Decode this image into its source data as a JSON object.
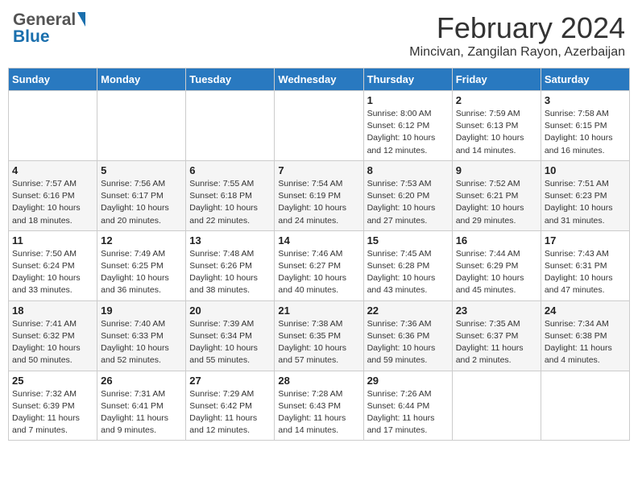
{
  "header": {
    "logo_general": "General",
    "logo_blue": "Blue",
    "month_year": "February 2024",
    "location": "Mincivan, Zangilan Rayon, Azerbaijan"
  },
  "weekdays": [
    "Sunday",
    "Monday",
    "Tuesday",
    "Wednesday",
    "Thursday",
    "Friday",
    "Saturday"
  ],
  "weeks": [
    [
      {
        "day": "",
        "info": ""
      },
      {
        "day": "",
        "info": ""
      },
      {
        "day": "",
        "info": ""
      },
      {
        "day": "",
        "info": ""
      },
      {
        "day": "1",
        "info": "Sunrise: 8:00 AM\nSunset: 6:12 PM\nDaylight: 10 hours\nand 12 minutes."
      },
      {
        "day": "2",
        "info": "Sunrise: 7:59 AM\nSunset: 6:13 PM\nDaylight: 10 hours\nand 14 minutes."
      },
      {
        "day": "3",
        "info": "Sunrise: 7:58 AM\nSunset: 6:15 PM\nDaylight: 10 hours\nand 16 minutes."
      }
    ],
    [
      {
        "day": "4",
        "info": "Sunrise: 7:57 AM\nSunset: 6:16 PM\nDaylight: 10 hours\nand 18 minutes."
      },
      {
        "day": "5",
        "info": "Sunrise: 7:56 AM\nSunset: 6:17 PM\nDaylight: 10 hours\nand 20 minutes."
      },
      {
        "day": "6",
        "info": "Sunrise: 7:55 AM\nSunset: 6:18 PM\nDaylight: 10 hours\nand 22 minutes."
      },
      {
        "day": "7",
        "info": "Sunrise: 7:54 AM\nSunset: 6:19 PM\nDaylight: 10 hours\nand 24 minutes."
      },
      {
        "day": "8",
        "info": "Sunrise: 7:53 AM\nSunset: 6:20 PM\nDaylight: 10 hours\nand 27 minutes."
      },
      {
        "day": "9",
        "info": "Sunrise: 7:52 AM\nSunset: 6:21 PM\nDaylight: 10 hours\nand 29 minutes."
      },
      {
        "day": "10",
        "info": "Sunrise: 7:51 AM\nSunset: 6:23 PM\nDaylight: 10 hours\nand 31 minutes."
      }
    ],
    [
      {
        "day": "11",
        "info": "Sunrise: 7:50 AM\nSunset: 6:24 PM\nDaylight: 10 hours\nand 33 minutes."
      },
      {
        "day": "12",
        "info": "Sunrise: 7:49 AM\nSunset: 6:25 PM\nDaylight: 10 hours\nand 36 minutes."
      },
      {
        "day": "13",
        "info": "Sunrise: 7:48 AM\nSunset: 6:26 PM\nDaylight: 10 hours\nand 38 minutes."
      },
      {
        "day": "14",
        "info": "Sunrise: 7:46 AM\nSunset: 6:27 PM\nDaylight: 10 hours\nand 40 minutes."
      },
      {
        "day": "15",
        "info": "Sunrise: 7:45 AM\nSunset: 6:28 PM\nDaylight: 10 hours\nand 43 minutes."
      },
      {
        "day": "16",
        "info": "Sunrise: 7:44 AM\nSunset: 6:29 PM\nDaylight: 10 hours\nand 45 minutes."
      },
      {
        "day": "17",
        "info": "Sunrise: 7:43 AM\nSunset: 6:31 PM\nDaylight: 10 hours\nand 47 minutes."
      }
    ],
    [
      {
        "day": "18",
        "info": "Sunrise: 7:41 AM\nSunset: 6:32 PM\nDaylight: 10 hours\nand 50 minutes."
      },
      {
        "day": "19",
        "info": "Sunrise: 7:40 AM\nSunset: 6:33 PM\nDaylight: 10 hours\nand 52 minutes."
      },
      {
        "day": "20",
        "info": "Sunrise: 7:39 AM\nSunset: 6:34 PM\nDaylight: 10 hours\nand 55 minutes."
      },
      {
        "day": "21",
        "info": "Sunrise: 7:38 AM\nSunset: 6:35 PM\nDaylight: 10 hours\nand 57 minutes."
      },
      {
        "day": "22",
        "info": "Sunrise: 7:36 AM\nSunset: 6:36 PM\nDaylight: 10 hours\nand 59 minutes."
      },
      {
        "day": "23",
        "info": "Sunrise: 7:35 AM\nSunset: 6:37 PM\nDaylight: 11 hours\nand 2 minutes."
      },
      {
        "day": "24",
        "info": "Sunrise: 7:34 AM\nSunset: 6:38 PM\nDaylight: 11 hours\nand 4 minutes."
      }
    ],
    [
      {
        "day": "25",
        "info": "Sunrise: 7:32 AM\nSunset: 6:39 PM\nDaylight: 11 hours\nand 7 minutes."
      },
      {
        "day": "26",
        "info": "Sunrise: 7:31 AM\nSunset: 6:41 PM\nDaylight: 11 hours\nand 9 minutes."
      },
      {
        "day": "27",
        "info": "Sunrise: 7:29 AM\nSunset: 6:42 PM\nDaylight: 11 hours\nand 12 minutes."
      },
      {
        "day": "28",
        "info": "Sunrise: 7:28 AM\nSunset: 6:43 PM\nDaylight: 11 hours\nand 14 minutes."
      },
      {
        "day": "29",
        "info": "Sunrise: 7:26 AM\nSunset: 6:44 PM\nDaylight: 11 hours\nand 17 minutes."
      },
      {
        "day": "",
        "info": ""
      },
      {
        "day": "",
        "info": ""
      }
    ]
  ]
}
